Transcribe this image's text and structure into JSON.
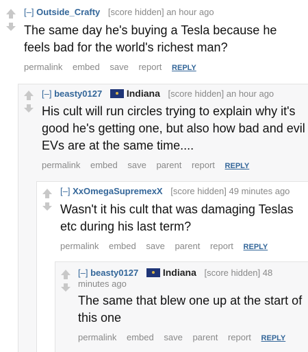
{
  "comments": [
    {
      "collapse": "[–]",
      "author": "Outside_Crafty",
      "score": "[score hidden] an hour ago",
      "body": "The same day he's buying a Tesla because he feels bad for the world's richest man?",
      "buttons": [
        "permalink",
        "embed",
        "save",
        "report"
      ],
      "reply": "REPLY"
    },
    {
      "collapse": "[–]",
      "author": "beasty0127",
      "flair": "Indiana",
      "score": "[score hidden] an hour ago",
      "body": "His cult will run circles trying to explain why it's good he's getting one, but also how bad and evil EVs are at the same time....",
      "buttons": [
        "permalink",
        "embed",
        "save",
        "parent",
        "report"
      ],
      "reply": "REPLY"
    },
    {
      "collapse": "[–]",
      "author": "XxOmegaSupremexX",
      "score": "[score hidden] 49 minutes ago",
      "body": "Wasn't it his cult that was damaging Teslas etc during his last term?",
      "buttons": [
        "permalink",
        "embed",
        "save",
        "parent",
        "report"
      ],
      "reply": "REPLY"
    },
    {
      "collapse": "[–]",
      "author": "beasty0127",
      "flair": "Indiana",
      "score": "[score hidden] 48 minutes ago",
      "body": "The same that blew one up at the start of this one",
      "buttons": [
        "permalink",
        "embed",
        "save",
        "parent",
        "report"
      ],
      "reply": "REPLY"
    }
  ]
}
